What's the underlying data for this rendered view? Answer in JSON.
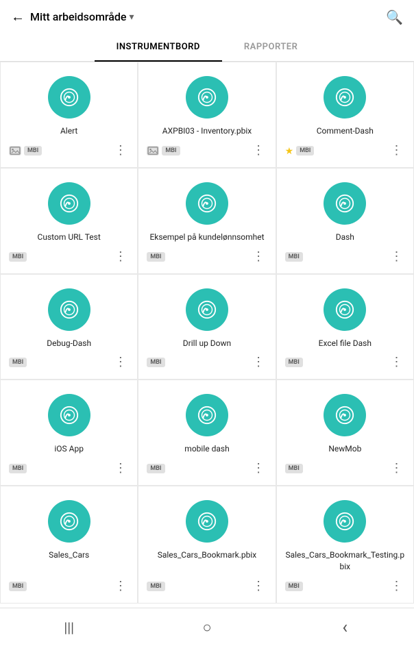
{
  "header": {
    "back_label": "←",
    "title": "Mitt arbeidsområde",
    "chevron": "▾",
    "search_label": "🔍"
  },
  "tabs": [
    {
      "id": "instrumentbord",
      "label": "INSTRUMENTBORD",
      "active": true
    },
    {
      "id": "rapporter",
      "label": "RAPPORTER",
      "active": false
    }
  ],
  "items": [
    {
      "id": 1,
      "title": "Alert",
      "has_image_icon": true,
      "has_star": false,
      "badge": "MBI"
    },
    {
      "id": 2,
      "title": "AXPBI03 - Inventory.pbix",
      "has_image_icon": true,
      "has_star": false,
      "badge": "MBI"
    },
    {
      "id": 3,
      "title": "Comment-Dash",
      "has_image_icon": false,
      "has_star": true,
      "badge": "MBI"
    },
    {
      "id": 4,
      "title": "Custom URL Test",
      "has_image_icon": false,
      "has_star": false,
      "badge": "MBI"
    },
    {
      "id": 5,
      "title": "Eksempel på kundelønnsomhet",
      "has_image_icon": false,
      "has_star": false,
      "badge": "MBI"
    },
    {
      "id": 6,
      "title": "Dash",
      "has_image_icon": false,
      "has_star": false,
      "badge": "MBI"
    },
    {
      "id": 7,
      "title": "Debug-Dash",
      "has_image_icon": false,
      "has_star": false,
      "badge": "MBI"
    },
    {
      "id": 8,
      "title": "Drill up Down",
      "has_image_icon": false,
      "has_star": false,
      "badge": "MBI"
    },
    {
      "id": 9,
      "title": "Excel file Dash",
      "has_image_icon": false,
      "has_star": false,
      "badge": "MBI"
    },
    {
      "id": 10,
      "title": "iOS App",
      "has_image_icon": false,
      "has_star": false,
      "badge": "MBI"
    },
    {
      "id": 11,
      "title": "mobile dash",
      "has_image_icon": false,
      "has_star": false,
      "badge": "MBI"
    },
    {
      "id": 12,
      "title": "NewMob",
      "has_image_icon": false,
      "has_star": false,
      "badge": "MBI"
    },
    {
      "id": 13,
      "title": "Sales_Cars",
      "has_image_icon": false,
      "has_star": false,
      "badge": "MBI"
    },
    {
      "id": 14,
      "title": "Sales_Cars_Bookmark.pbix",
      "has_image_icon": false,
      "has_star": false,
      "badge": "MBI"
    },
    {
      "id": 15,
      "title": "Sales_Cars_Bookmark_Testing.pbix",
      "has_image_icon": false,
      "has_star": false,
      "badge": "MBI"
    }
  ],
  "bottom_nav": {
    "menu_icon": "|||",
    "home_icon": "○",
    "back_icon": "‹"
  }
}
